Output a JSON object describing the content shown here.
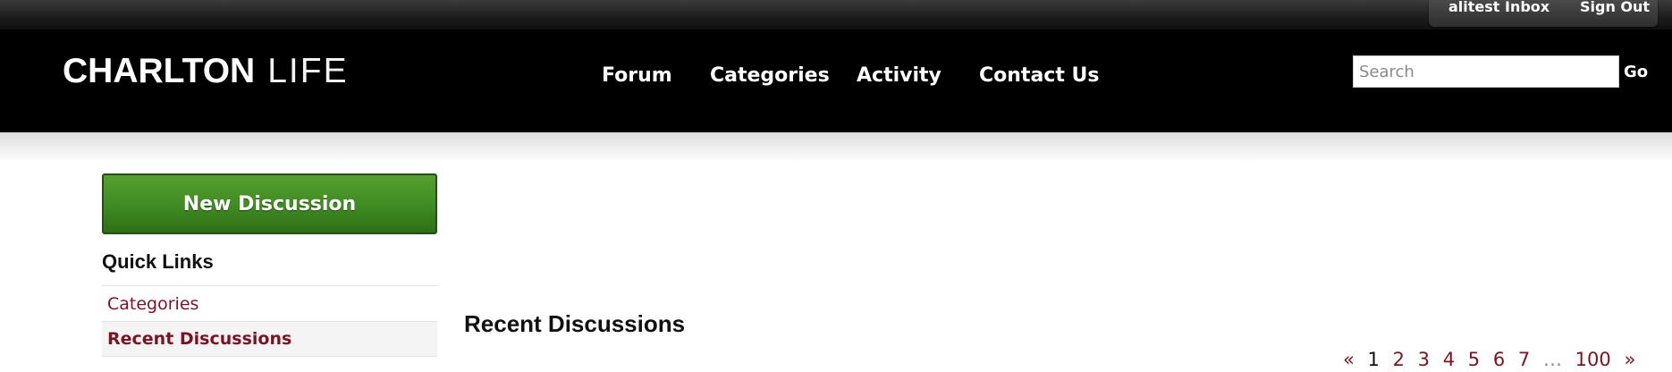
{
  "user_bar": {
    "username": "alitest",
    "inbox": "Inbox",
    "sign_out": "Sign Out"
  },
  "header": {
    "logo_bold": "CHARLTON",
    "logo_light": "LIFE",
    "nav": [
      "Forum",
      "Categories",
      "Activity",
      "Contact Us"
    ],
    "search_placeholder": "Search",
    "go_label": "Go"
  },
  "sidebar": {
    "new_discussion": "New Discussion",
    "quick_links_title": "Quick Links",
    "quick_links": [
      "Categories",
      "Recent Discussions"
    ],
    "active_link": "Recent Discussions"
  },
  "main": {
    "title": "Recent Discussions",
    "pager": {
      "prev": "«",
      "pages": [
        "1",
        "2",
        "3",
        "4",
        "5",
        "6",
        "7"
      ],
      "current_page": "1",
      "ellipsis": "…",
      "last": "100",
      "next": "»"
    }
  },
  "colors": {
    "header_bg": "#000000",
    "accent_link": "#7a1424",
    "button_green": "#3f8a22"
  }
}
